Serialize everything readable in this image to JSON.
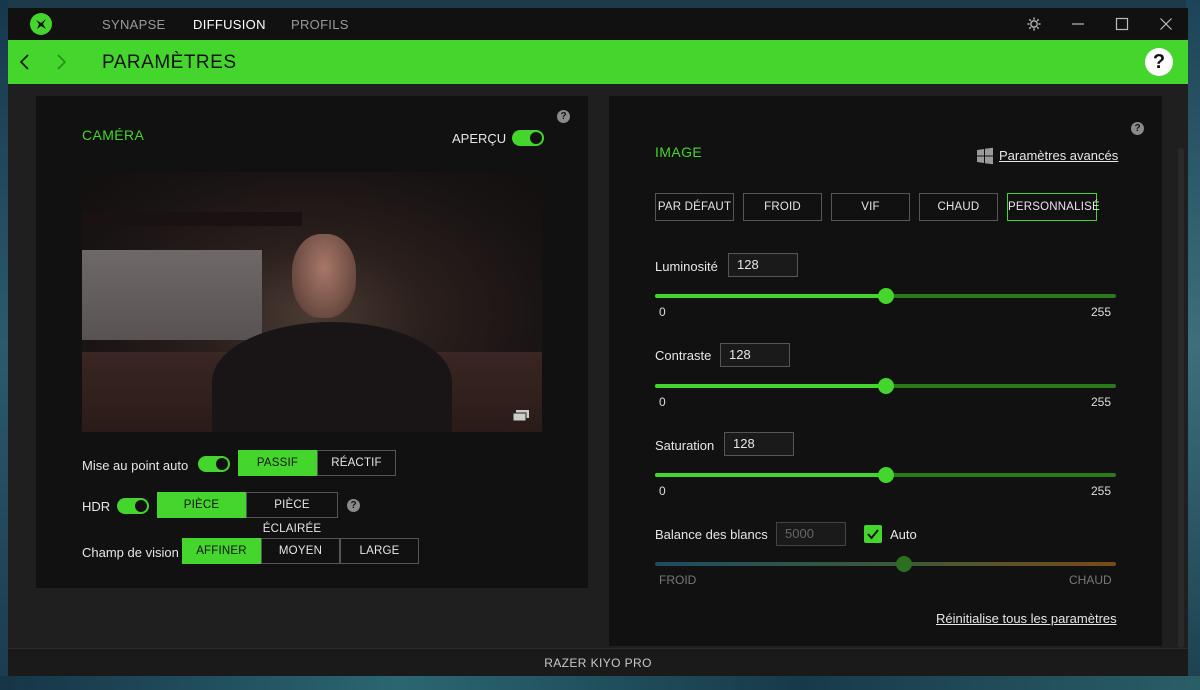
{
  "nav": {
    "tabs": [
      "SYNAPSE",
      "DIFFUSION",
      "PROFILS"
    ],
    "active_index": 1
  },
  "header": {
    "title": "PARAMÈTRES",
    "help_symbol": "?"
  },
  "camera_panel": {
    "title": "CAMÉRA",
    "preview_label": "APERÇU",
    "preview_on": true,
    "autofocus": {
      "label": "Mise au point auto",
      "on": true,
      "options": [
        "PASSIF",
        "RÉACTIF"
      ],
      "selected": "PASSIF"
    },
    "hdr": {
      "label": "HDR",
      "on": true,
      "options": [
        "PIÈCE SOMBRE",
        "PIÈCE ÉCLAIRÉE"
      ],
      "selected": "PIÈCE SOMBRE"
    },
    "fov": {
      "label": "Champ de vision",
      "options": [
        "AFFINER",
        "MOYEN",
        "LARGE"
      ],
      "selected": "AFFINER"
    }
  },
  "image_panel": {
    "title": "IMAGE",
    "advanced_link": "Paramètres avancés",
    "presets": [
      "PAR DÉFAUT",
      "FROID",
      "VIF",
      "CHAUD",
      "PERSONNALISÉ"
    ],
    "selected_preset": "PERSONNALISÉ",
    "brightness": {
      "label": "Luminosité",
      "value": 128,
      "min": "0",
      "max": "255"
    },
    "contrast": {
      "label": "Contraste",
      "value": 128,
      "min": "0",
      "max": "255"
    },
    "saturation": {
      "label": "Saturation",
      "value": 128,
      "min": "0",
      "max": "255"
    },
    "white_balance": {
      "label": "Balance des blancs",
      "value": "5000",
      "auto_label": "Auto",
      "auto_checked": true,
      "min_label": "FROID",
      "max_label": "CHAUD",
      "level": 0.54
    },
    "reset_link": "Réinitialise tous les paramètres"
  },
  "footer": {
    "device": "RAZER KIYO PRO"
  },
  "colors": {
    "accent": "#44d62c",
    "panel": "#111111",
    "window": "#1f1f1f"
  }
}
